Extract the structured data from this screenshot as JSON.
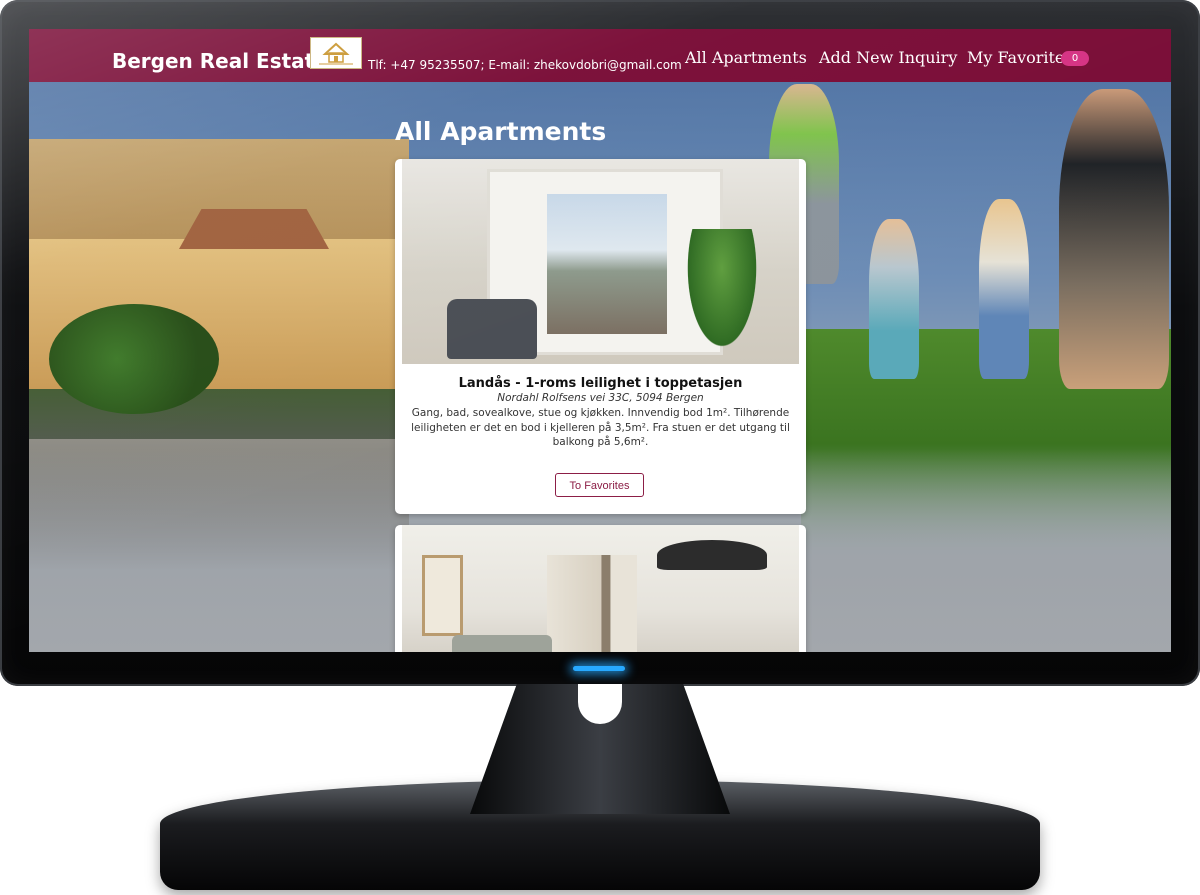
{
  "navbar": {
    "brand": "Bergen Real Estate",
    "contact": "Tlf: +47 95235507; E-mail: zhekovdobri@gmail.com",
    "links": [
      "All Apartments",
      "Add New Inquiry",
      "My Favorites"
    ],
    "favorites_count": "0"
  },
  "main": {
    "title": "All Apartments",
    "listings": [
      {
        "title": "Landås - 1-roms leilighet i toppetasjen",
        "address": "Nordahl Rolfsens vei 33C, 5094 Bergen",
        "description": "Gang, bad, sovealkove, stue og kjøkken. Innvendig bod 1m². Tilhørende leiligheten er det en bod i kjelleren på 3,5m². Fra stuen er det utgang til balkong på 5,6m².",
        "button": "To Favorites"
      }
    ]
  },
  "colors": {
    "navbar": "#7a0d37",
    "badge": "#d63384",
    "button_border": "#8c1e46",
    "power_led": "#27a9ff"
  }
}
